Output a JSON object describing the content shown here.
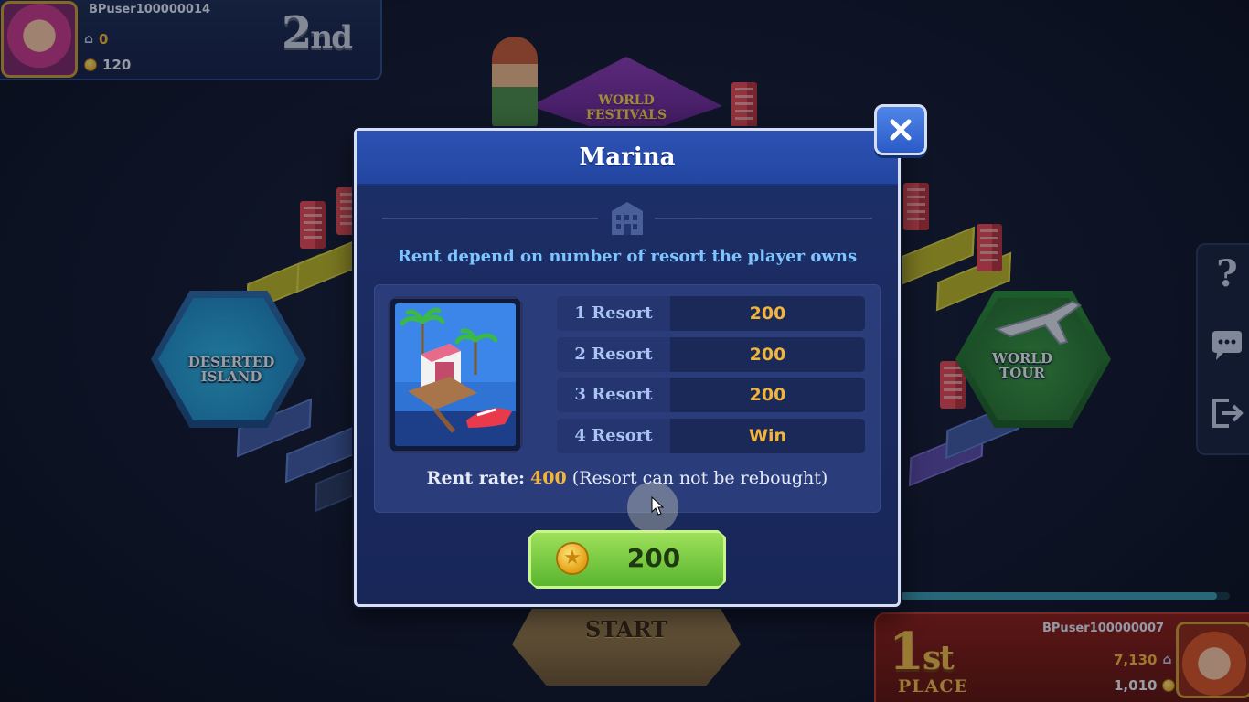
{
  "board": {
    "labels": {
      "deserted_island": "DESERTED\nISLAND",
      "world_tour": "WORLD\nTOUR",
      "world_festivals": "WORLD\nFESTIVALS",
      "start": "START"
    }
  },
  "player_top_left": {
    "username": "BPuser100000014",
    "houses": "0",
    "coins": "120",
    "rank_number": "2",
    "rank_suffix": "nd"
  },
  "player_bottom_right": {
    "username": "BPuser100000007",
    "houses": "7,130",
    "coins": "1,010",
    "rank_number": "1",
    "rank_suffix": "st",
    "place_label": "PLACE"
  },
  "side_tools": {
    "help": "?",
    "chat_icon": "chat-icon",
    "exit_icon": "exit-icon"
  },
  "turn_progress": 0.96,
  "dialog": {
    "title": "Marina",
    "description": "Rent depend on number of resort the player owns",
    "rent_table": [
      {
        "label": "1 Resort",
        "value": "200"
      },
      {
        "label": "2 Resort",
        "value": "200"
      },
      {
        "label": "3 Resort",
        "value": "200"
      },
      {
        "label": "4 Resort",
        "value": "Win"
      }
    ],
    "rent_rate_label": "Rent rate:",
    "rent_rate_value": "400",
    "rent_rate_note": "(Resort can not be rebought)",
    "buy_price": "200",
    "close_icon": "close-icon"
  },
  "colors": {
    "accent_gold": "#f2b53a",
    "dialog_blue": "#2246a0",
    "buy_green": "#5ab52e",
    "description_blue": "#7ec4ff"
  }
}
